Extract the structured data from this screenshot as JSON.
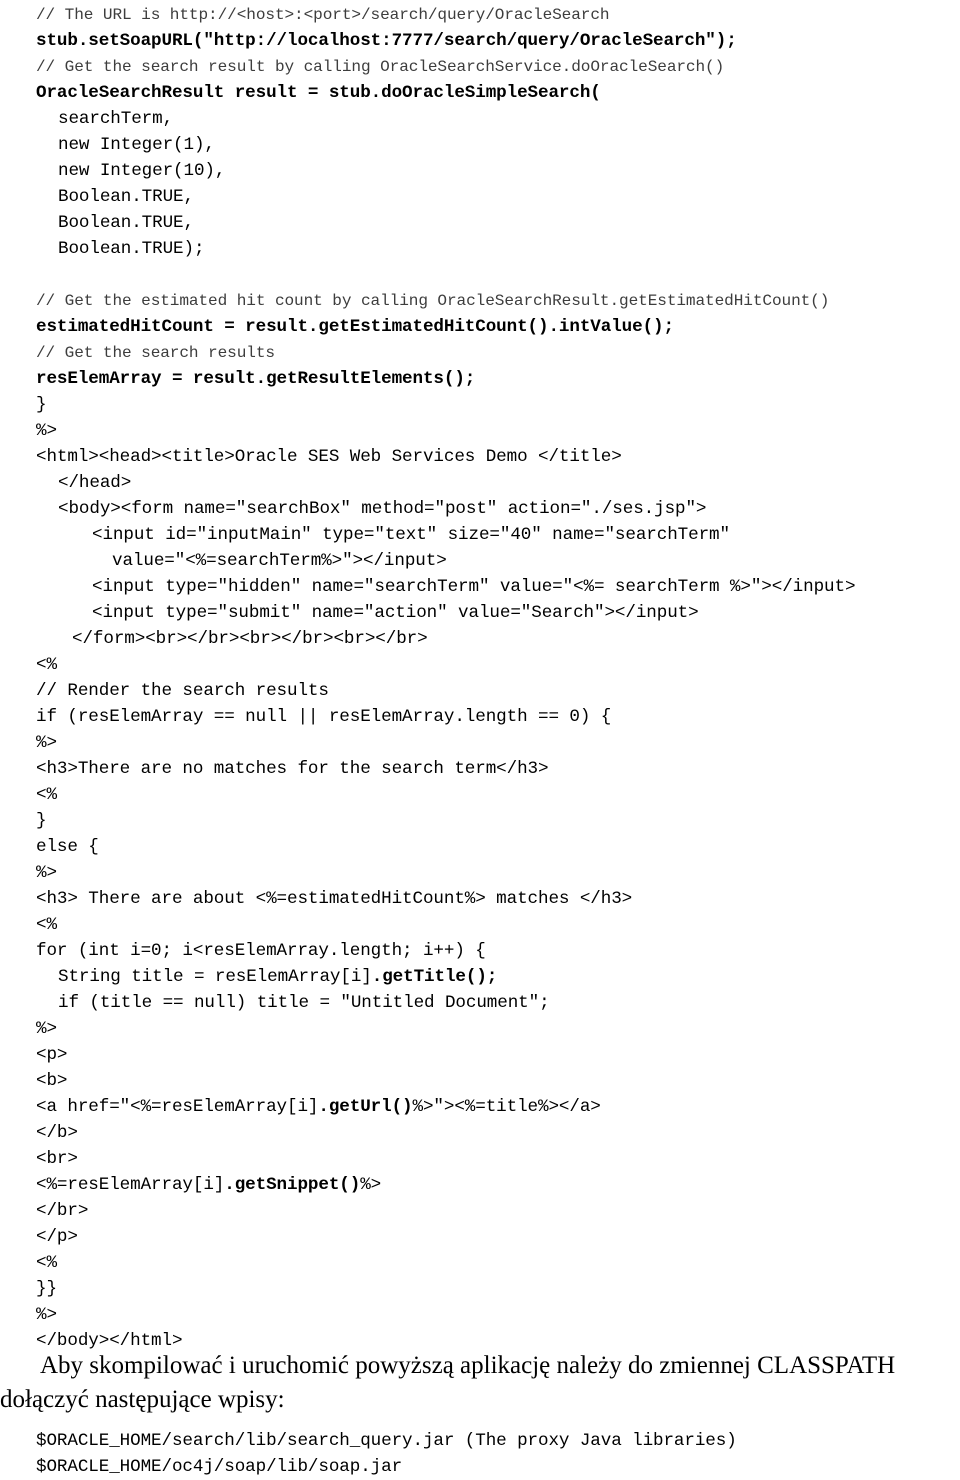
{
  "document": {
    "type": "code-listing-page",
    "language": "jsp",
    "code_lines": [
      {
        "text": "// The URL is http://<host>:<port>/search/query/OracleSearch",
        "style": "comment",
        "indent": 0
      },
      {
        "text": "stub.setSoapURL(\"http://localhost:7777/search/query/OracleSearch\");",
        "style": "bold",
        "indent": 0
      },
      {
        "text": "// Get the search result by calling OracleSearchService.doOracleSearch()",
        "style": "comment",
        "indent": 0
      },
      {
        "text": "OracleSearchResult result = stub.doOracleSimpleSearch(",
        "style": "bold",
        "indent": 0
      },
      {
        "text": "searchTerm,",
        "style": "plain",
        "indent": 1
      },
      {
        "text": "new Integer(1),",
        "style": "plain",
        "indent": 1
      },
      {
        "text": "new Integer(10),",
        "style": "plain",
        "indent": 1
      },
      {
        "text": "Boolean.TRUE,",
        "style": "plain",
        "indent": 1
      },
      {
        "text": "Boolean.TRUE,",
        "style": "plain",
        "indent": 1
      },
      {
        "text": "Boolean.TRUE);",
        "style": "plain",
        "indent": 1
      },
      {
        "text": "",
        "style": "blank",
        "indent": 0
      },
      {
        "text": "// Get the estimated hit count by calling OracleSearchResult.getEstimatedHitCount()",
        "style": "comment",
        "indent": 0
      },
      {
        "text": "estimatedHitCount = result.getEstimatedHitCount().intValue();",
        "style": "bold",
        "indent": 0
      },
      {
        "text": "// Get the search results",
        "style": "comment",
        "indent": 0
      },
      {
        "text": "resElemArray = result.getResultElements();",
        "style": "bold",
        "indent": 0
      },
      {
        "text": "}",
        "style": "plain",
        "indent": 0
      },
      {
        "text": "%>",
        "style": "plain",
        "indent": 0
      },
      {
        "text": "<html><head><title>Oracle SES Web Services Demo </title>",
        "style": "plain",
        "indent": 0
      },
      {
        "text": "</head>",
        "style": "plain",
        "indent": 1
      },
      {
        "text": "<body><form name=\"searchBox\" method=\"post\" action=\"./ses.jsp\">",
        "style": "plain",
        "indent": 1
      },
      {
        "text": "<input id=\"inputMain\" type=\"text\" size=\"40\" name=\"searchTerm\"",
        "style": "plain",
        "indent": 3
      },
      {
        "text": "value=\"<%=searchTerm%>\"></input>",
        "style": "plain",
        "indent": 4
      },
      {
        "text": "<input type=\"hidden\" name=\"searchTerm\" value=\"<%= searchTerm %>\"></input>",
        "style": "plain",
        "indent": 3
      },
      {
        "text": "<input type=\"submit\" name=\"action\" value=\"Search\"></input>",
        "style": "plain",
        "indent": 3
      },
      {
        "text": "</form><br></br><br></br><br></br>",
        "style": "plain",
        "indent": 2
      },
      {
        "text": "<%",
        "style": "plain",
        "indent": 0
      },
      {
        "text": "// Render the search results",
        "style": "plain",
        "indent": 0
      },
      {
        "text": "if (resElemArray == null || resElemArray.length == 0) {",
        "style": "plain",
        "indent": 0
      },
      {
        "text": "%>",
        "style": "plain",
        "indent": 0
      },
      {
        "text": "<h3>There are no matches for the search term</h3>",
        "style": "plain",
        "indent": 0
      },
      {
        "text": "<%",
        "style": "plain",
        "indent": 0
      },
      {
        "text": "}",
        "style": "plain",
        "indent": 0
      },
      {
        "text": "else {",
        "style": "plain",
        "indent": 0
      },
      {
        "text": "%>",
        "style": "plain",
        "indent": 0
      },
      {
        "text": "<h3> There are about <%=estimatedHitCount%> matches </h3>",
        "style": "plain",
        "indent": 0
      },
      {
        "text": "<%",
        "style": "plain",
        "indent": 0
      },
      {
        "text": "for (int i=0; i<resElemArray.length; i++) {",
        "style": "plain",
        "indent": 0
      },
      {
        "text": "String title = resElemArray[i].getTitle();",
        "style": "mixed",
        "indent": 1,
        "bold_part": ".getTitle();",
        "plain_part": "String title = resElemArray[i]"
      },
      {
        "text": "if (title == null) title = \"Untitled Document\";",
        "style": "plain",
        "indent": 1
      },
      {
        "text": "%>",
        "style": "plain",
        "indent": 0
      },
      {
        "text": "<p>",
        "style": "plain",
        "indent": 0
      },
      {
        "text": "<b>",
        "style": "plain",
        "indent": 0
      },
      {
        "text": "<a href=\"<%=resElemArray[i].getUrl()%>\"><%=title%></a>",
        "style": "mixed",
        "indent": 0,
        "plain_part": "<a href=\"<%=resElemArray[i]",
        "bold_part": ".getUrl()",
        "tail_part": "%>\"><%=title%></a>"
      },
      {
        "text": "</b>",
        "style": "plain",
        "indent": 0
      },
      {
        "text": "<br>",
        "style": "plain",
        "indent": 0
      },
      {
        "text": "<%=resElemArray[i].getSnippet()%>",
        "style": "mixed",
        "indent": 0,
        "plain_part": "<%=resElemArray[i]",
        "bold_part": ".getSnippet()",
        "tail_part": "%>"
      },
      {
        "text": "</br>",
        "style": "plain",
        "indent": 0
      },
      {
        "text": "</p>",
        "style": "plain",
        "indent": 0
      },
      {
        "text": "<%",
        "style": "plain",
        "indent": 0
      },
      {
        "text": "}}",
        "style": "plain",
        "indent": 0
      },
      {
        "text": "%>",
        "style": "plain",
        "indent": 0
      },
      {
        "text": "</body></html>",
        "style": "plain",
        "indent": 0
      }
    ],
    "paragraph": "Aby skompilować i uruchomić powyższą aplikację należy do zmiennej CLASSPATH dołączyć następujące wpisy:",
    "classpath_lines": [
      "$ORACLE_HOME/search/lib/search_query.jar (The proxy Java libraries)",
      "$ORACLE_HOME/oc4j/soap/lib/soap.jar"
    ]
  }
}
